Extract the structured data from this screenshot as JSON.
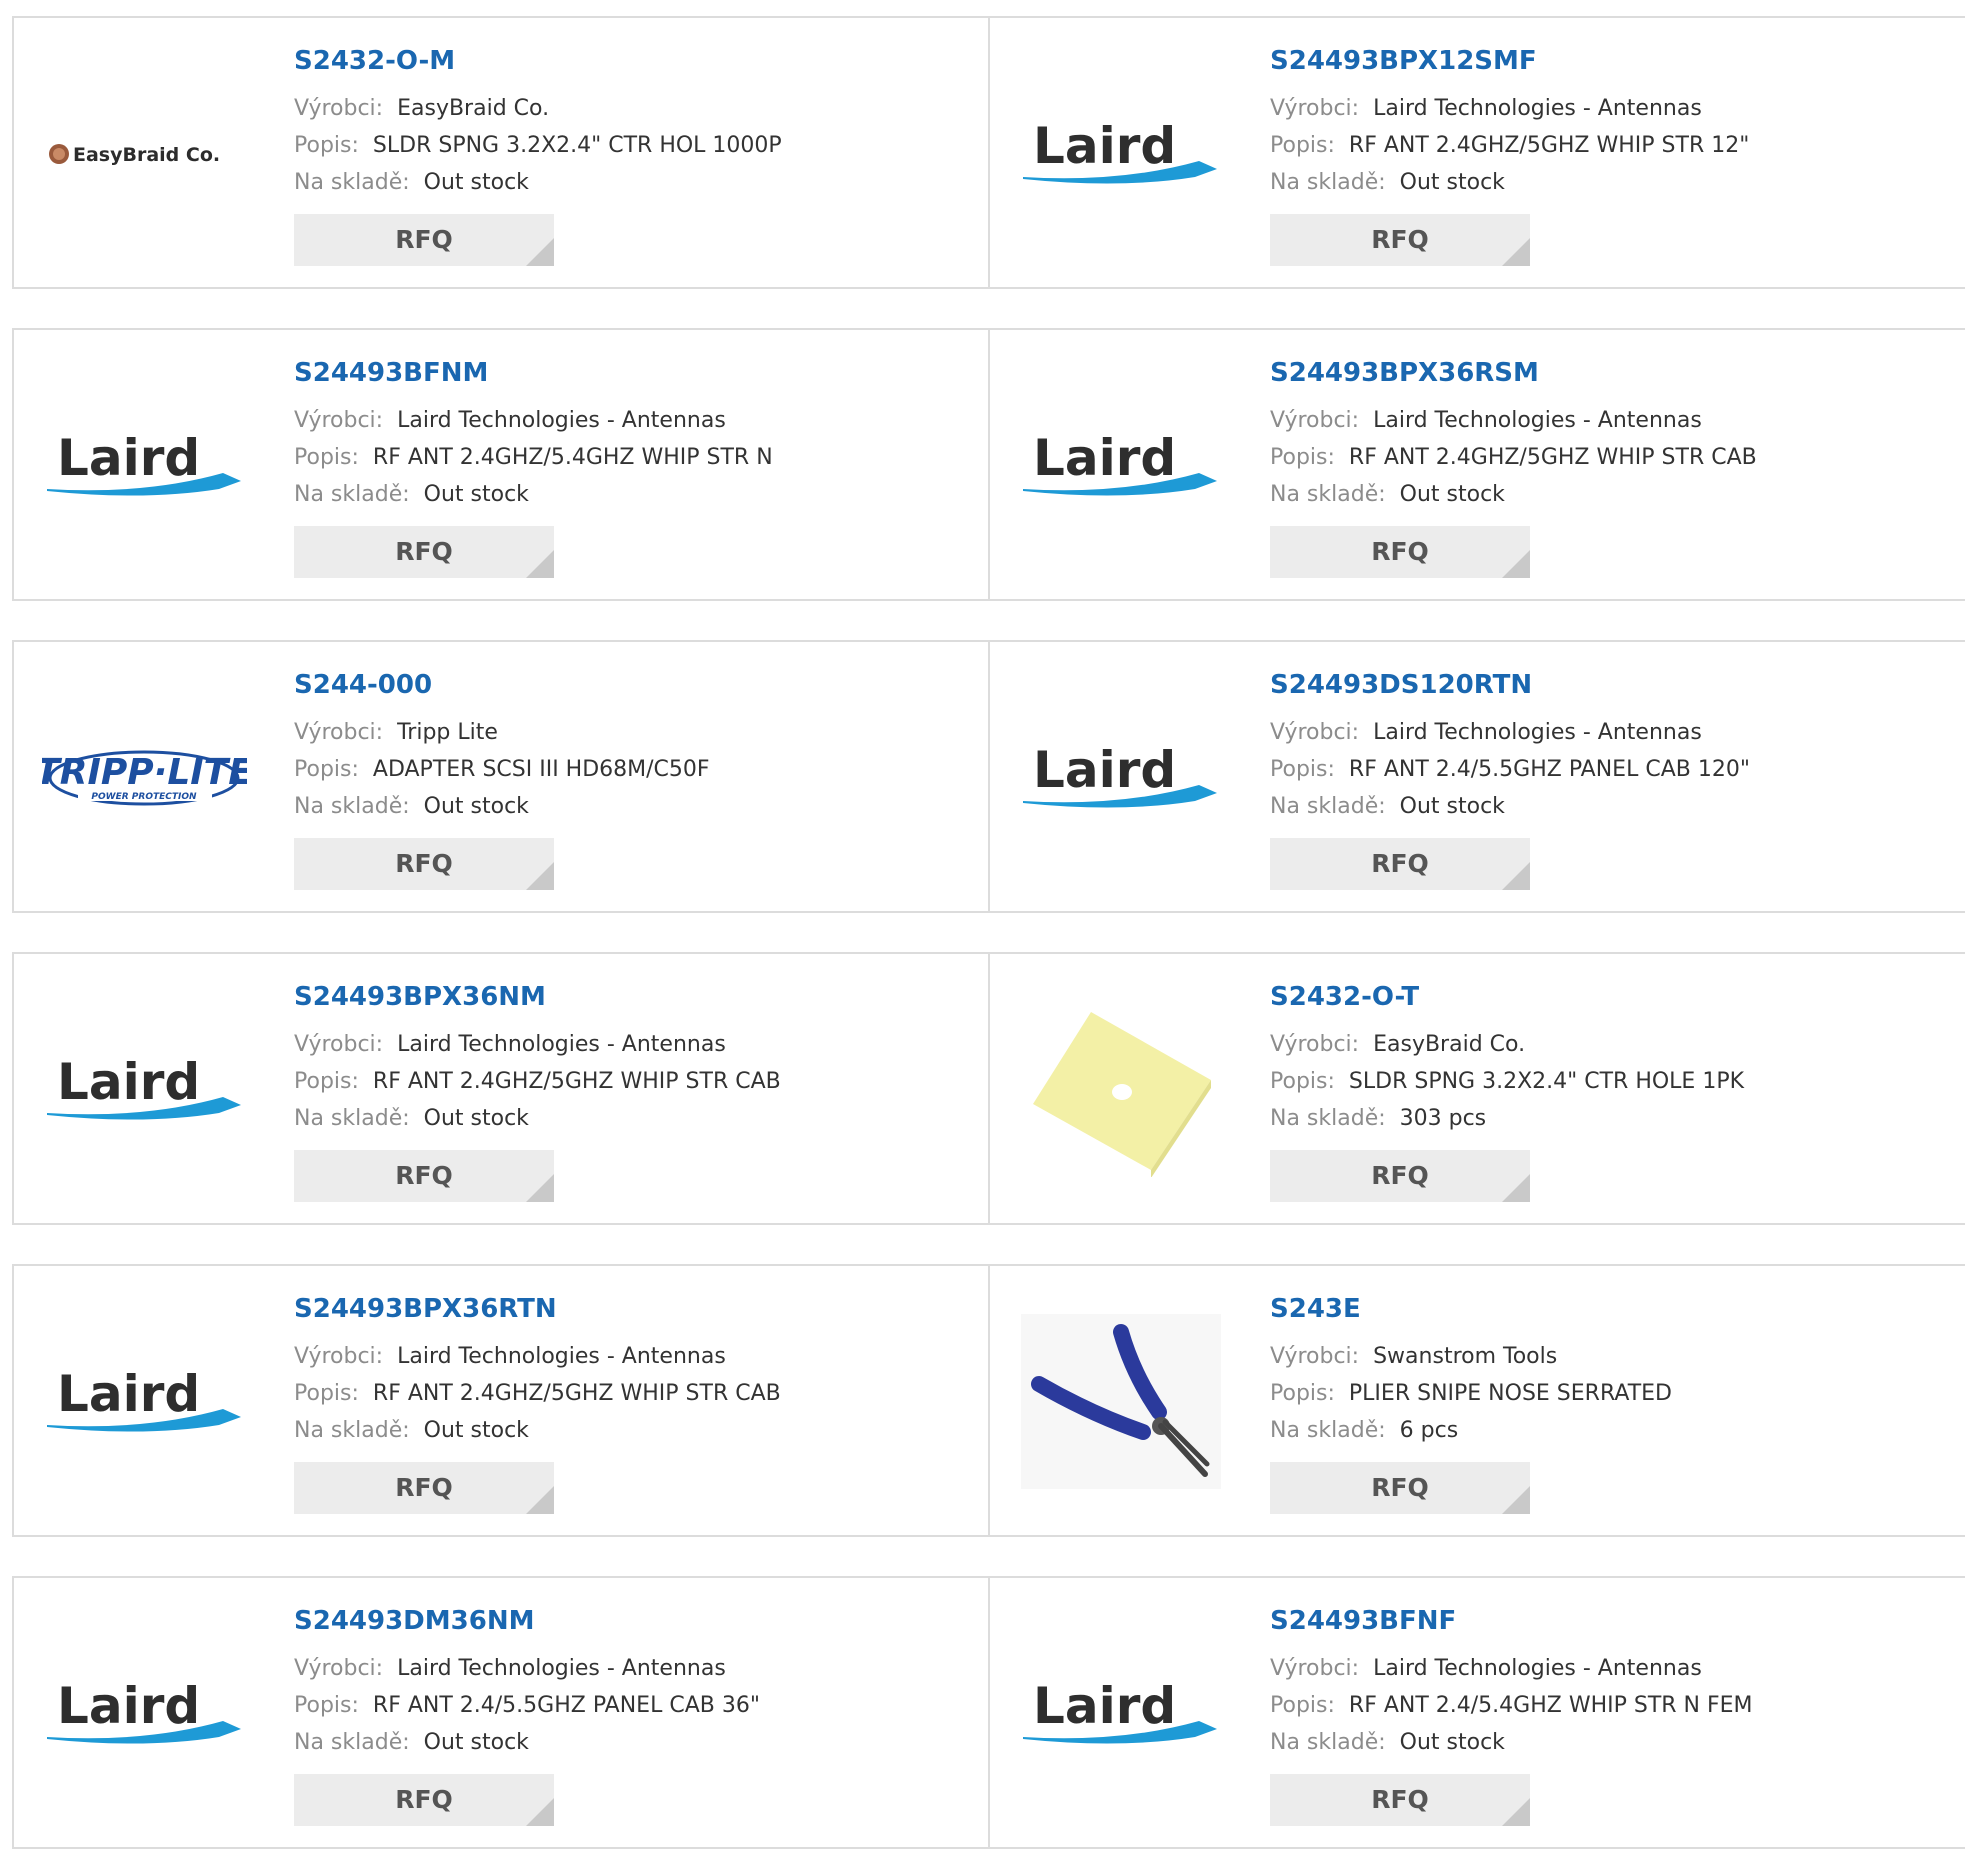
{
  "labels": {
    "manufacturer": "Výrobci:",
    "description": "Popis:",
    "stock": "Na skladě:",
    "rfq": "RFQ"
  },
  "products": [
    {
      "pn": "S2432-O-M",
      "manufacturer": "EasyBraid Co.",
      "description": "SLDR SPNG 3.2X2.4\" CTR HOL 1000P",
      "stock": "Out stock",
      "logo": "easybraid-logo",
      "logo_text": "EasyBraid Co."
    },
    {
      "pn": "S24493BPX12SMF",
      "manufacturer": "Laird Technologies - Antennas",
      "description": "RF ANT 2.4GHZ/5GHZ WHIP STR 12\"",
      "stock": "Out stock",
      "logo": "laird-logo",
      "logo_text": "Laird"
    },
    {
      "pn": "S24493BFNM",
      "manufacturer": "Laird Technologies - Antennas",
      "description": "RF ANT 2.4GHZ/5.4GHZ WHIP STR N",
      "stock": "Out stock",
      "logo": "laird-logo",
      "logo_text": "Laird"
    },
    {
      "pn": "S24493BPX36RSM",
      "manufacturer": "Laird Technologies - Antennas",
      "description": "RF ANT 2.4GHZ/5GHZ WHIP STR CAB",
      "stock": "Out stock",
      "logo": "laird-logo",
      "logo_text": "Laird"
    },
    {
      "pn": "S244-000",
      "manufacturer": "Tripp Lite",
      "description": "ADAPTER SCSI III HD68M/C50F",
      "stock": "Out stock",
      "logo": "tripp-lite-logo",
      "logo_text": "TRIPP·LITE",
      "logo_subtext": "POWER PROTECTION"
    },
    {
      "pn": "S24493DS120RTN",
      "manufacturer": "Laird Technologies - Antennas",
      "description": "RF ANT 2.4/5.5GHZ PANEL CAB 120\"",
      "stock": "Out stock",
      "logo": "laird-logo",
      "logo_text": "Laird"
    },
    {
      "pn": "S24493BPX36NM",
      "manufacturer": "Laird Technologies - Antennas",
      "description": "RF ANT 2.4GHZ/5GHZ WHIP STR CAB",
      "stock": "Out stock",
      "logo": "laird-logo",
      "logo_text": "Laird"
    },
    {
      "pn": "S2432-O-T",
      "manufacturer": "EasyBraid Co.",
      "description": "SLDR SPNG 3.2X2.4\" CTR HOLE 1PK",
      "stock": "303 pcs",
      "logo": "sponge-image"
    },
    {
      "pn": "S24493BPX36RTN",
      "manufacturer": "Laird Technologies - Antennas",
      "description": "RF ANT 2.4GHZ/5GHZ WHIP STR CAB",
      "stock": "Out stock",
      "logo": "laird-logo",
      "logo_text": "Laird"
    },
    {
      "pn": "S243E",
      "manufacturer": "Swanstrom Tools",
      "description": "PLIER SNIPE NOSE SERRATED",
      "stock": "6 pcs",
      "logo": "pliers-image"
    },
    {
      "pn": "S24493DM36NM",
      "manufacturer": "Laird Technologies - Antennas",
      "description": "RF ANT 2.4/5.5GHZ PANEL CAB 36\"",
      "stock": "Out stock",
      "logo": "laird-logo",
      "logo_text": "Laird"
    },
    {
      "pn": "S24493BFNF",
      "manufacturer": "Laird Technologies - Antennas",
      "description": "RF ANT 2.4/5.4GHZ WHIP STR N FEM",
      "stock": "Out stock",
      "logo": "laird-logo",
      "logo_text": "Laird"
    }
  ],
  "colors": {
    "link": "#1a67b0",
    "label": "#8c8c8c",
    "border": "#dcdcdc",
    "rfq_bg": "#ececec",
    "laird_swoosh": "#1e9ad6"
  }
}
